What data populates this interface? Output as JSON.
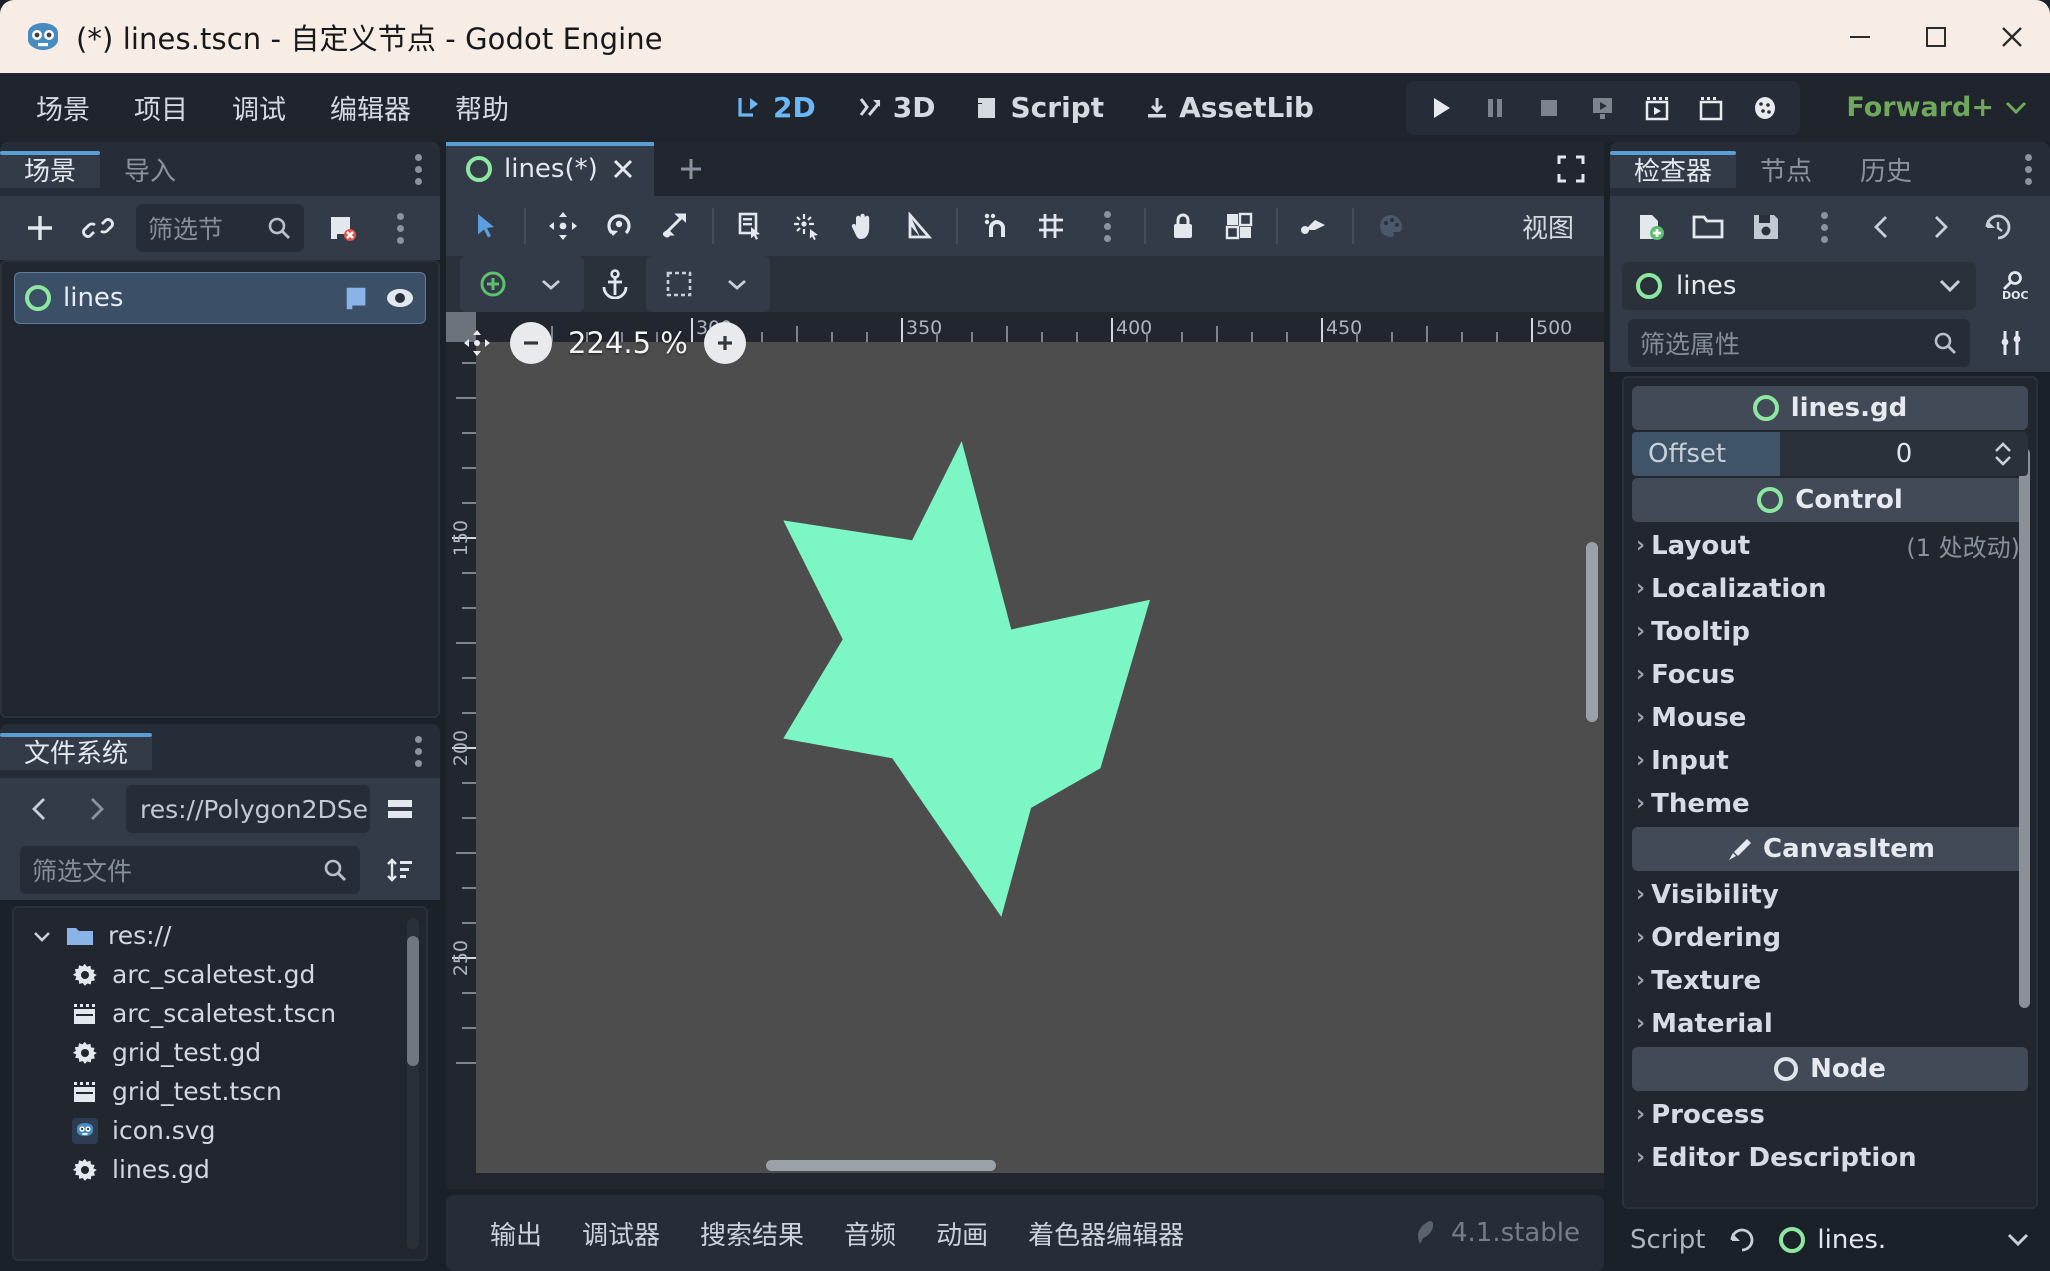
{
  "window": {
    "title": "(*) lines.tscn - 自定义节点 - Godot Engine",
    "minimize_label": "minimize",
    "maximize_label": "maximize",
    "close_label": "close"
  },
  "menubar": {
    "items": [
      "场景",
      "项目",
      "调试",
      "编辑器",
      "帮助"
    ],
    "modes": [
      {
        "label": "2D",
        "icon": "2d-icon",
        "active": true
      },
      {
        "label": "3D",
        "icon": "3d-icon",
        "active": false
      },
      {
        "label": "Script",
        "icon": "script-icon",
        "active": false
      },
      {
        "label": "AssetLib",
        "icon": "assetlib-icon",
        "active": false
      }
    ],
    "play_buttons": [
      "play-icon",
      "pause-icon",
      "stop-icon",
      "play-scene-icon",
      "play-custom-scene-icon",
      "movie-writer-icon",
      "remote-debug-icon"
    ],
    "renderer": "Forward+",
    "renderer_caret": "chevron-down-icon"
  },
  "scene_dock": {
    "tabs": [
      {
        "label": "场景",
        "active": true
      },
      {
        "label": "导入",
        "active": false
      }
    ],
    "toolbar": {
      "add_label": "add-node",
      "link_label": "instantiate-scene",
      "filter_placeholder": "筛选节",
      "script_label": "detach-script",
      "menu_label": "scene-menu"
    },
    "tree": [
      {
        "name": "lines",
        "icon": "control-node-icon",
        "selected": true,
        "has_script": true,
        "visible": true
      }
    ]
  },
  "filesystem_dock": {
    "tab": "文件系统",
    "path": "res://Polygon2DSe",
    "filter_placeholder": "筛选文件",
    "nav_back": "chevron-left-icon",
    "nav_forward": "chevron-right-icon",
    "split_mode": "split-mode-icon",
    "sort": "sort-icon",
    "files": [
      {
        "name": "res://",
        "icon": "folder-icon",
        "depth": 0,
        "expanded": true
      },
      {
        "name": "arc_scaletest.gd",
        "icon": "gdscript-icon",
        "depth": 1
      },
      {
        "name": "arc_scaletest.tscn",
        "icon": "packed-scene-icon",
        "depth": 1
      },
      {
        "name": "grid_test.gd",
        "icon": "gdscript-icon",
        "depth": 1
      },
      {
        "name": "grid_test.tscn",
        "icon": "packed-scene-icon",
        "depth": 1
      },
      {
        "name": "icon.svg",
        "icon": "godot-icon",
        "depth": 1
      },
      {
        "name": "lines.gd",
        "icon": "gdscript-icon",
        "depth": 1
      }
    ]
  },
  "editor": {
    "scene_tabs": [
      {
        "label": "lines(*)",
        "icon": "control-node-icon",
        "active": true,
        "close": "close-icon"
      }
    ],
    "new_tab": "add-icon",
    "expand": "distraction-free-icon",
    "toolbar_icons": [
      "select-mode-icon",
      "move-mode-icon",
      "rotate-mode-icon",
      "scale-mode-icon",
      "list-select-icon",
      "pivot-icon",
      "pan-mode-icon",
      "ruler-mode-icon",
      "snap-mode-icon",
      "grid-snap-icon",
      "snap-options-icon",
      "lock-icon",
      "group-icon",
      "skeleton-icon",
      "theme-preview-icon"
    ],
    "view_label": "视图",
    "toolbar2_icons": [
      "add-point-icon",
      "add-point-options-icon",
      "anchor-icon",
      "rect-select-icon",
      "rect-options-icon"
    ],
    "zoom": {
      "reset_icon": "zoom-fit-icon",
      "minus": "−",
      "value": "224.5 %",
      "plus": "+"
    },
    "ruler": {
      "h_labels": [
        "300",
        "350",
        "400",
        "450",
        "500"
      ],
      "v_labels": [
        "150",
        "200",
        "250"
      ]
    },
    "canvas": {
      "background_color": "#4d4d4d",
      "shape_name": "star-polygon",
      "shape_color": "#7cf6c4"
    }
  },
  "bottom_panel": {
    "tabs": [
      "输出",
      "调试器",
      "搜索结果",
      "音频",
      "动画",
      "着色器编辑器"
    ],
    "version": "4.1.stable",
    "version_icon": "godot-feather-icon"
  },
  "inspector": {
    "tabs": [
      {
        "label": "检查器",
        "active": true
      },
      {
        "label": "节点",
        "active": false
      },
      {
        "label": "历史",
        "active": false
      }
    ],
    "toolbar": [
      "new-resource-icon",
      "load-resource-icon",
      "save-resource-icon",
      "resource-menu-icon",
      "history-back-icon",
      "history-forward-icon",
      "history-icon"
    ],
    "node_name": "lines",
    "node_icon": "control-node-icon",
    "node_dropdown": "chevron-down-icon",
    "doc_icon": "open-doc-icon",
    "filter_placeholder": "筛选属性",
    "tools_icon": "object-tools-icon",
    "rows": [
      {
        "kind": "category",
        "label": "lines.gd",
        "icon": "control-node-icon"
      },
      {
        "kind": "offset",
        "label": "Offset",
        "value": "0"
      },
      {
        "kind": "category",
        "label": "Control",
        "icon": "control-node-icon"
      },
      {
        "kind": "group",
        "label": "Layout",
        "badge": "(1 处改动)"
      },
      {
        "kind": "group",
        "label": "Localization"
      },
      {
        "kind": "group",
        "label": "Tooltip"
      },
      {
        "kind": "group",
        "label": "Focus"
      },
      {
        "kind": "group",
        "label": "Mouse"
      },
      {
        "kind": "group",
        "label": "Input"
      },
      {
        "kind": "group",
        "label": "Theme"
      },
      {
        "kind": "category",
        "label": "CanvasItem",
        "icon": "brush-icon"
      },
      {
        "kind": "group",
        "label": "Visibility"
      },
      {
        "kind": "group",
        "label": "Ordering"
      },
      {
        "kind": "group",
        "label": "Texture"
      },
      {
        "kind": "group",
        "label": "Material"
      },
      {
        "kind": "category",
        "label": "Node",
        "icon": "node-icon"
      },
      {
        "kind": "group",
        "label": "Process"
      },
      {
        "kind": "group",
        "label": "Editor Description"
      }
    ],
    "script_row": {
      "label": "Script",
      "revert_icon": "revert-icon",
      "value": "lines.",
      "value_icon": "control-node-icon",
      "dropdown": "chevron-down-icon"
    }
  }
}
